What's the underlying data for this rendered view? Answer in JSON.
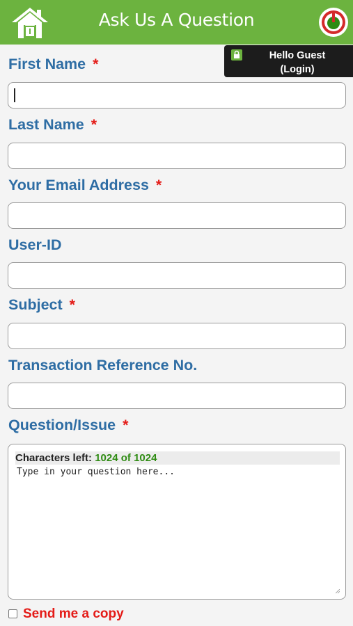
{
  "header": {
    "title": "Ask Us A Question",
    "home_icon": "home-icon",
    "power_icon": "power-icon",
    "color": "#6cb33f"
  },
  "user_box": {
    "line1": "Hello Guest",
    "line2": "(Login)",
    "icon": "lock-icon"
  },
  "form": {
    "required_marker": "*",
    "fields": [
      {
        "label": "First Name",
        "required": true,
        "value": ""
      },
      {
        "label": "Last Name",
        "required": true,
        "value": ""
      },
      {
        "label": "Your Email Address",
        "required": true,
        "value": ""
      },
      {
        "label": "User-ID",
        "required": false,
        "value": ""
      },
      {
        "label": "Subject",
        "required": true,
        "value": ""
      },
      {
        "label": "Transaction Reference No.",
        "required": false,
        "value": ""
      }
    ],
    "question": {
      "label": "Question/Issue",
      "required": true,
      "chars_left_label": "Characters left:",
      "chars_left_count": "1024 of 1024",
      "placeholder": "Type in your question here..."
    },
    "send_copy": {
      "label": "Send me a copy",
      "checked": false
    }
  },
  "colors": {
    "label": "#2e6da4",
    "required": "#e41b17",
    "count": "#2e8b12"
  }
}
